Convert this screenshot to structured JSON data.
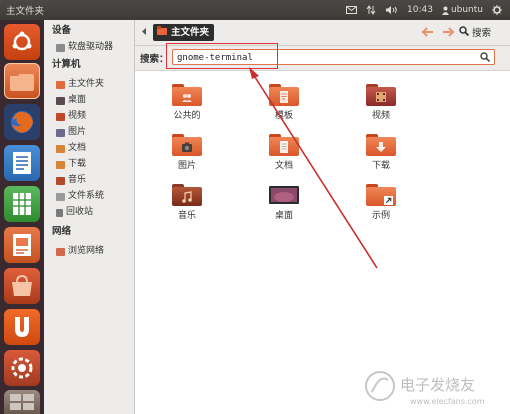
{
  "topbar": {
    "title": "主文件夹",
    "time": "10:43",
    "user": "ubuntu"
  },
  "toolbar": {
    "breadcrumb": "主文件夹",
    "search_label": "搜索"
  },
  "search": {
    "label": "搜索：",
    "value": "gnome-terminal"
  },
  "sidebar": {
    "sections": [
      {
        "title": "设备",
        "items": [
          {
            "label": "软盘驱动器",
            "icon": "floppy-icon"
          }
        ]
      },
      {
        "title": "计算机",
        "items": [
          {
            "label": "主文件夹",
            "icon": "home-icon"
          },
          {
            "label": "桌面",
            "icon": "desktop-icon"
          },
          {
            "label": "视频",
            "icon": "video-icon"
          },
          {
            "label": "图片",
            "icon": "pictures-icon"
          },
          {
            "label": "文档",
            "icon": "documents-icon"
          },
          {
            "label": "下载",
            "icon": "downloads-icon"
          },
          {
            "label": "音乐",
            "icon": "music-icon"
          },
          {
            "label": "文件系统",
            "icon": "filesystem-icon"
          },
          {
            "label": "回收站",
            "icon": "trash-icon"
          }
        ]
      },
      {
        "title": "网络",
        "items": [
          {
            "label": "浏览网络",
            "icon": "network-icon"
          }
        ]
      }
    ]
  },
  "files": [
    {
      "label": "公共的",
      "icon": "public-folder-icon"
    },
    {
      "label": "模板",
      "icon": "templates-folder-icon"
    },
    {
      "label": "视频",
      "icon": "videos-folder-icon"
    },
    {
      "label": "图片",
      "icon": "pictures-folder-icon"
    },
    {
      "label": "文档",
      "icon": "documents-folder-icon"
    },
    {
      "label": "下载",
      "icon": "downloads-folder-icon"
    },
    {
      "label": "音乐",
      "icon": "music-folder-icon"
    },
    {
      "label": "桌面",
      "icon": "desktop-folder-icon"
    },
    {
      "label": "示例",
      "icon": "examples-folder-icon"
    }
  ],
  "watermark": {
    "brand": "电子发烧友",
    "url": "www.elecfans.com"
  },
  "colors": {
    "accent": "#dd4814",
    "topbar": "#3c3b37",
    "launcher": "#3a2a2f",
    "annotation": "#d8343a"
  }
}
